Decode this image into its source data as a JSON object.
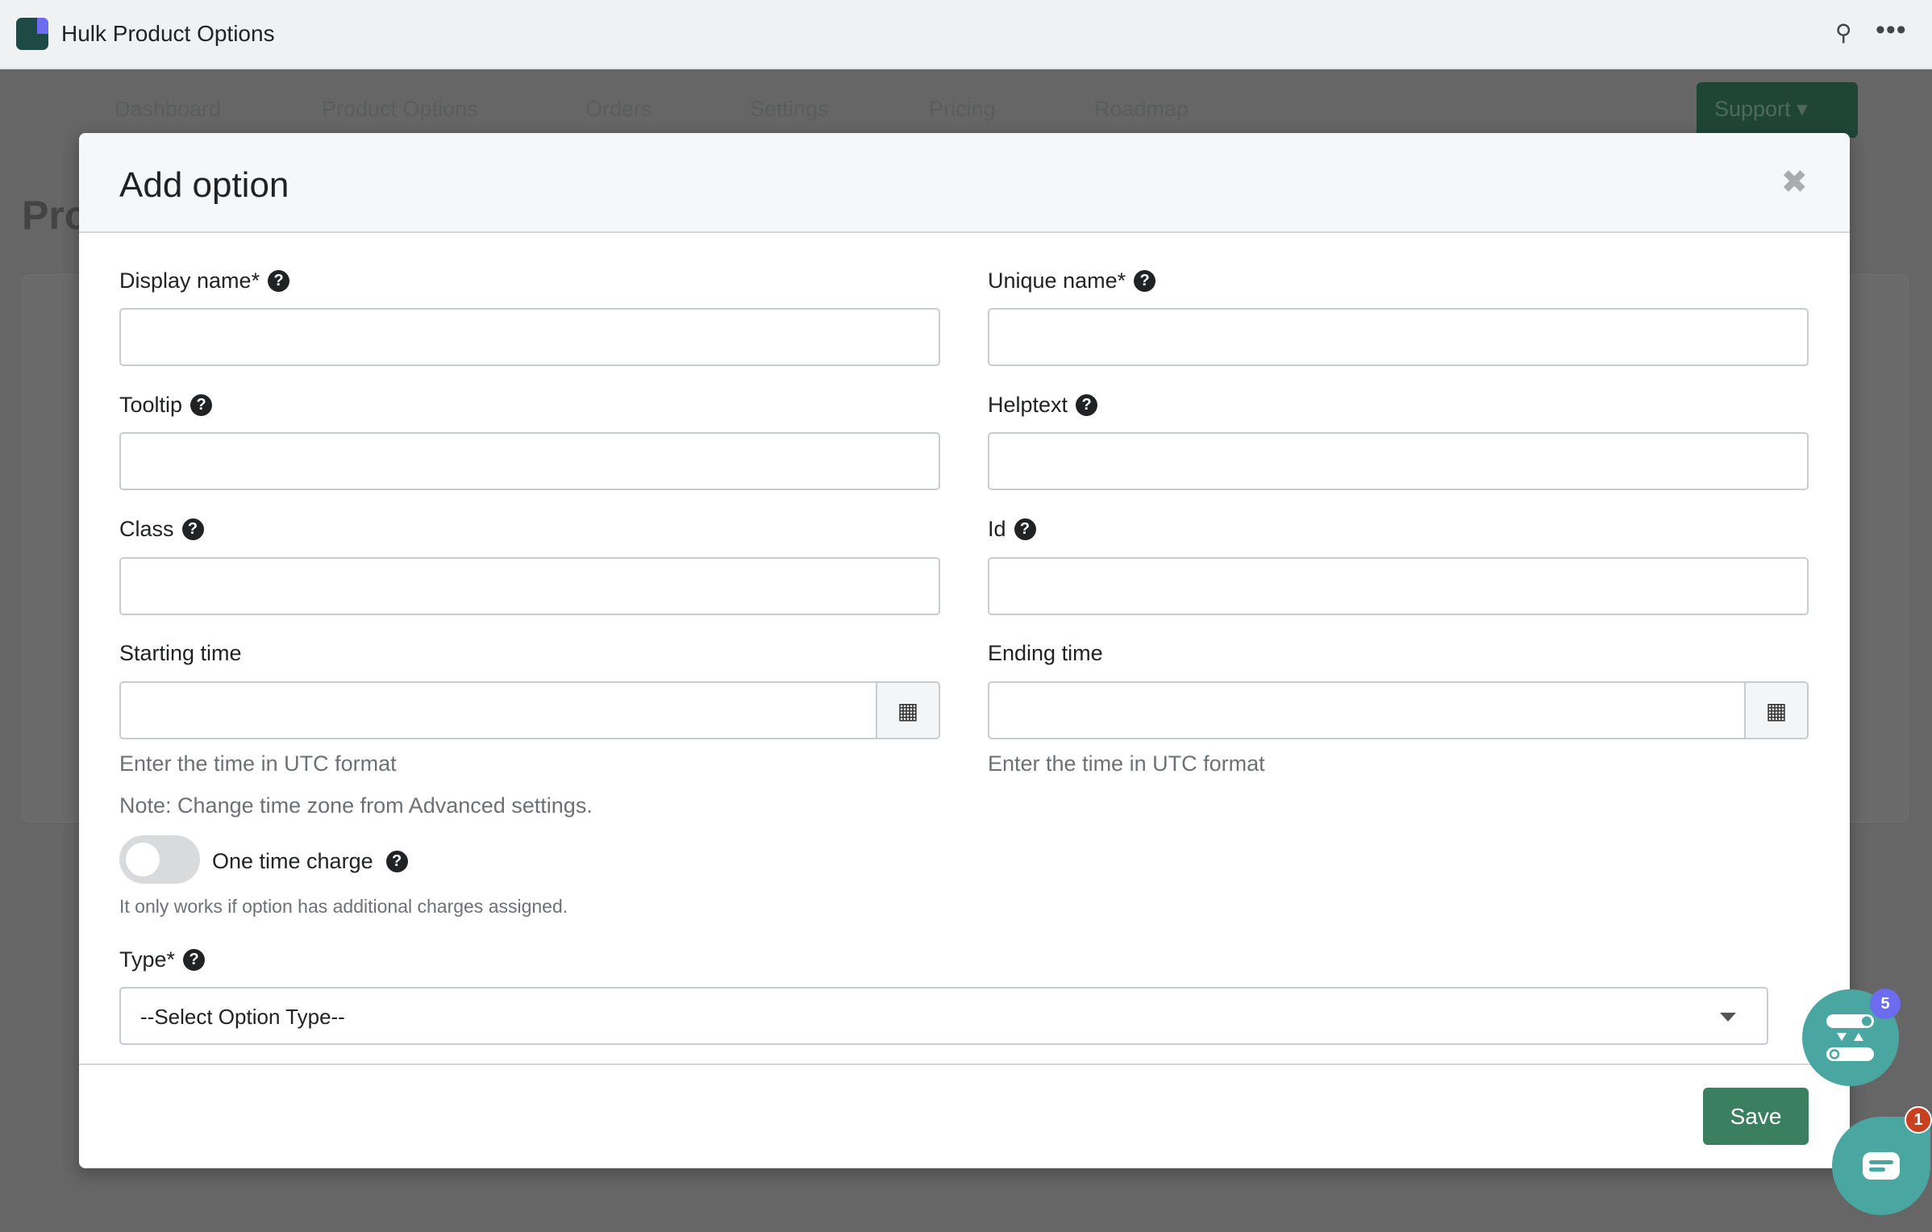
{
  "app": {
    "title": "Hulk Product Options"
  },
  "background": {
    "nav": [
      "Dashboard",
      "Product Options",
      "Orders",
      "Settings",
      "Pricing",
      "Roadmap"
    ],
    "support_label": "Support",
    "page_title": "Pro"
  },
  "modal": {
    "title": "Add option",
    "fields": {
      "display_name": {
        "label": "Display name*",
        "value": ""
      },
      "unique_name": {
        "label": "Unique name*",
        "value": ""
      },
      "tooltip": {
        "label": "Tooltip",
        "value": ""
      },
      "helptext": {
        "label": "Helptext",
        "value": ""
      },
      "class": {
        "label": "Class",
        "value": ""
      },
      "id": {
        "label": "Id",
        "value": ""
      },
      "starting_time": {
        "label": "Starting time",
        "value": "",
        "help": "Enter the time in UTC format"
      },
      "ending_time": {
        "label": "Ending time",
        "value": "",
        "help": "Enter the time in UTC format"
      }
    },
    "note": "Note: Change time zone from Advanced settings.",
    "one_time_charge": {
      "label": "One time charge",
      "enabled": false,
      "help": "It only works if option has additional charges assigned."
    },
    "type": {
      "label": "Type*",
      "selected": "--Select Option Type--"
    },
    "save_label": "Save"
  },
  "widgets": {
    "options_badge": "5",
    "chat_badge": "1",
    "colors": {
      "fab": "#4aa6a0",
      "badge_purple": "#6c6cf0",
      "badge_red": "#c8401f"
    }
  }
}
